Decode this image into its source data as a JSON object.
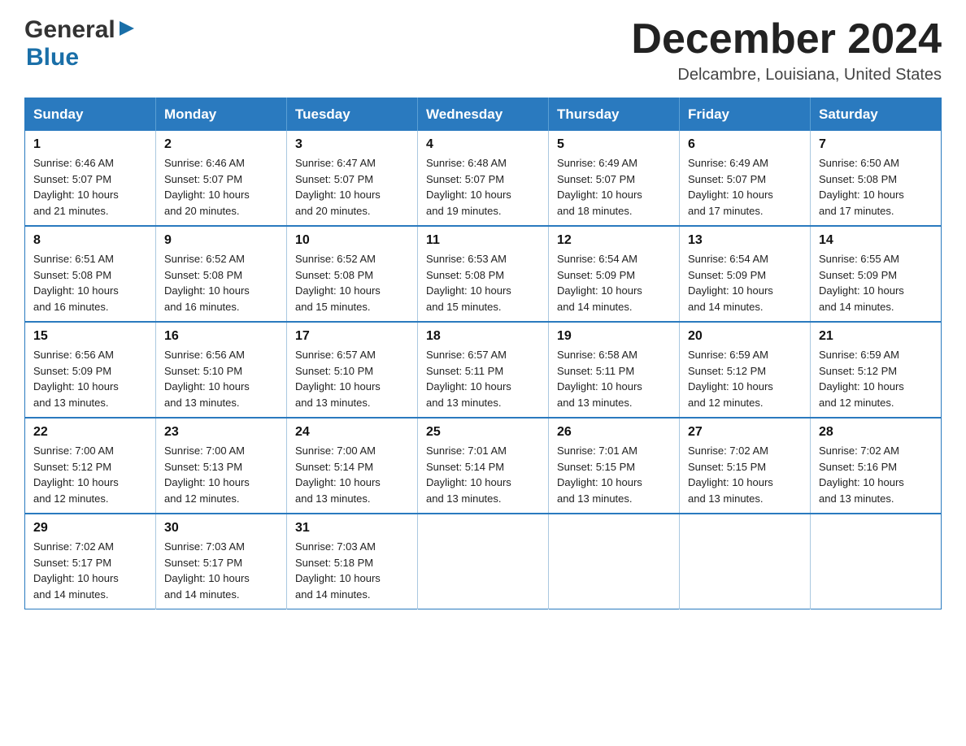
{
  "header": {
    "logo": {
      "general": "General",
      "blue": "Blue"
    },
    "title": "December 2024",
    "location": "Delcambre, Louisiana, United States"
  },
  "calendar": {
    "days_of_week": [
      "Sunday",
      "Monday",
      "Tuesday",
      "Wednesday",
      "Thursday",
      "Friday",
      "Saturday"
    ],
    "weeks": [
      [
        {
          "day": "1",
          "sunrise": "6:46 AM",
          "sunset": "5:07 PM",
          "daylight": "10 hours and 21 minutes."
        },
        {
          "day": "2",
          "sunrise": "6:46 AM",
          "sunset": "5:07 PM",
          "daylight": "10 hours and 20 minutes."
        },
        {
          "day": "3",
          "sunrise": "6:47 AM",
          "sunset": "5:07 PM",
          "daylight": "10 hours and 20 minutes."
        },
        {
          "day": "4",
          "sunrise": "6:48 AM",
          "sunset": "5:07 PM",
          "daylight": "10 hours and 19 minutes."
        },
        {
          "day": "5",
          "sunrise": "6:49 AM",
          "sunset": "5:07 PM",
          "daylight": "10 hours and 18 minutes."
        },
        {
          "day": "6",
          "sunrise": "6:49 AM",
          "sunset": "5:07 PM",
          "daylight": "10 hours and 17 minutes."
        },
        {
          "day": "7",
          "sunrise": "6:50 AM",
          "sunset": "5:08 PM",
          "daylight": "10 hours and 17 minutes."
        }
      ],
      [
        {
          "day": "8",
          "sunrise": "6:51 AM",
          "sunset": "5:08 PM",
          "daylight": "10 hours and 16 minutes."
        },
        {
          "day": "9",
          "sunrise": "6:52 AM",
          "sunset": "5:08 PM",
          "daylight": "10 hours and 16 minutes."
        },
        {
          "day": "10",
          "sunrise": "6:52 AM",
          "sunset": "5:08 PM",
          "daylight": "10 hours and 15 minutes."
        },
        {
          "day": "11",
          "sunrise": "6:53 AM",
          "sunset": "5:08 PM",
          "daylight": "10 hours and 15 minutes."
        },
        {
          "day": "12",
          "sunrise": "6:54 AM",
          "sunset": "5:09 PM",
          "daylight": "10 hours and 14 minutes."
        },
        {
          "day": "13",
          "sunrise": "6:54 AM",
          "sunset": "5:09 PM",
          "daylight": "10 hours and 14 minutes."
        },
        {
          "day": "14",
          "sunrise": "6:55 AM",
          "sunset": "5:09 PM",
          "daylight": "10 hours and 14 minutes."
        }
      ],
      [
        {
          "day": "15",
          "sunrise": "6:56 AM",
          "sunset": "5:09 PM",
          "daylight": "10 hours and 13 minutes."
        },
        {
          "day": "16",
          "sunrise": "6:56 AM",
          "sunset": "5:10 PM",
          "daylight": "10 hours and 13 minutes."
        },
        {
          "day": "17",
          "sunrise": "6:57 AM",
          "sunset": "5:10 PM",
          "daylight": "10 hours and 13 minutes."
        },
        {
          "day": "18",
          "sunrise": "6:57 AM",
          "sunset": "5:11 PM",
          "daylight": "10 hours and 13 minutes."
        },
        {
          "day": "19",
          "sunrise": "6:58 AM",
          "sunset": "5:11 PM",
          "daylight": "10 hours and 13 minutes."
        },
        {
          "day": "20",
          "sunrise": "6:59 AM",
          "sunset": "5:12 PM",
          "daylight": "10 hours and 12 minutes."
        },
        {
          "day": "21",
          "sunrise": "6:59 AM",
          "sunset": "5:12 PM",
          "daylight": "10 hours and 12 minutes."
        }
      ],
      [
        {
          "day": "22",
          "sunrise": "7:00 AM",
          "sunset": "5:12 PM",
          "daylight": "10 hours and 12 minutes."
        },
        {
          "day": "23",
          "sunrise": "7:00 AM",
          "sunset": "5:13 PM",
          "daylight": "10 hours and 12 minutes."
        },
        {
          "day": "24",
          "sunrise": "7:00 AM",
          "sunset": "5:14 PM",
          "daylight": "10 hours and 13 minutes."
        },
        {
          "day": "25",
          "sunrise": "7:01 AM",
          "sunset": "5:14 PM",
          "daylight": "10 hours and 13 minutes."
        },
        {
          "day": "26",
          "sunrise": "7:01 AM",
          "sunset": "5:15 PM",
          "daylight": "10 hours and 13 minutes."
        },
        {
          "day": "27",
          "sunrise": "7:02 AM",
          "sunset": "5:15 PM",
          "daylight": "10 hours and 13 minutes."
        },
        {
          "day": "28",
          "sunrise": "7:02 AM",
          "sunset": "5:16 PM",
          "daylight": "10 hours and 13 minutes."
        }
      ],
      [
        {
          "day": "29",
          "sunrise": "7:02 AM",
          "sunset": "5:17 PM",
          "daylight": "10 hours and 14 minutes."
        },
        {
          "day": "30",
          "sunrise": "7:03 AM",
          "sunset": "5:17 PM",
          "daylight": "10 hours and 14 minutes."
        },
        {
          "day": "31",
          "sunrise": "7:03 AM",
          "sunset": "5:18 PM",
          "daylight": "10 hours and 14 minutes."
        },
        null,
        null,
        null,
        null
      ]
    ],
    "labels": {
      "sunrise": "Sunrise:",
      "sunset": "Sunset:",
      "daylight": "Daylight:"
    }
  }
}
